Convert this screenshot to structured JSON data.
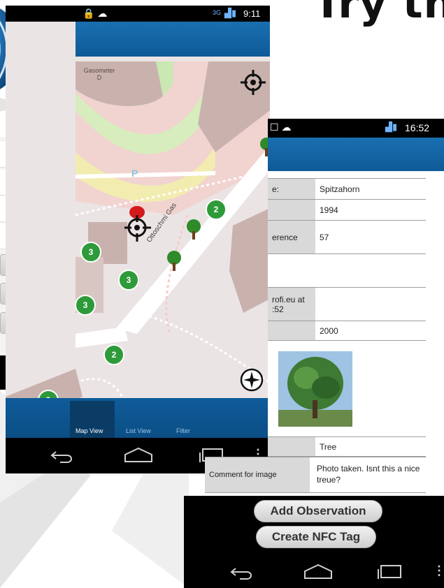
{
  "headline": "Try th",
  "map_phone": {
    "status_time": "9:11",
    "network_badge": "3G",
    "place_label": "Gasometer\nD",
    "street_label": "Ottoschmi Gas",
    "park_letter": "P",
    "clusters": [
      "3",
      "3",
      "3",
      "2",
      "2",
      "2"
    ],
    "tabs": [
      "Map View",
      "List View",
      "Filter"
    ],
    "active_tab": "Map View"
  },
  "detail_phone": {
    "status_time": "16:52",
    "rows": [
      {
        "label": "e:",
        "value": "Spitzahorn"
      },
      {
        "label": "",
        "value": "1994"
      },
      {
        "label": "erence",
        "value": "57"
      },
      {
        "label": "",
        "value": ""
      },
      {
        "label": "rofi.eu at\n:52",
        "value": ""
      },
      {
        "label": "",
        "value": "2000"
      },
      {
        "label": "",
        "value": ""
      },
      {
        "label": "",
        "value": "Tree"
      },
      {
        "label": "Comment for image",
        "value": "Photo taken. Isnt this a nice treue?"
      }
    ],
    "add_observation": "Add Observation",
    "create_nfc": "Create NFC Tag"
  },
  "colors": {
    "appbar": "#1565a8",
    "cluster": "#2e9a3a",
    "map_bg": "#ebe4e4"
  }
}
